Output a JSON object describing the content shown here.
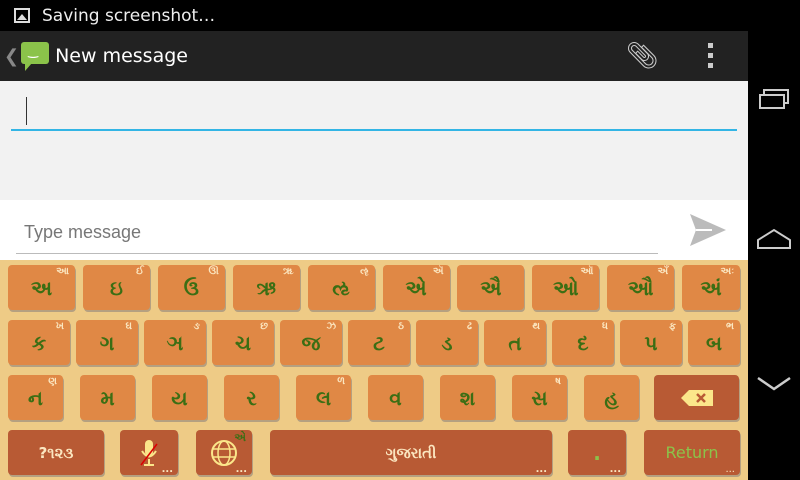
{
  "status": {
    "text": "Saving screenshot…"
  },
  "action_bar": {
    "title": "New message"
  },
  "recipient": {
    "value": ""
  },
  "compose": {
    "placeholder": "Type message"
  },
  "keyboard": {
    "row1": [
      [
        "અ",
        "આ"
      ],
      [
        "ઇ",
        "ઈ"
      ],
      [
        "ઉ",
        "ઊ"
      ],
      [
        "ઋ",
        "ૠ"
      ],
      [
        "ઌ",
        "ૡ"
      ],
      [
        "એ",
        "ઍ"
      ],
      [
        "ઐ",
        ""
      ],
      [
        "ઓ",
        "ઑ"
      ],
      [
        "ઔ",
        "અઁ"
      ],
      [
        "અં",
        "અઃ"
      ]
    ],
    "row2": [
      [
        "ક",
        "ખ"
      ],
      [
        "ગ",
        "ઘ"
      ],
      [
        "ઞ",
        "ઙ"
      ],
      [
        "ચ",
        "છ"
      ],
      [
        "જ",
        "ઝ"
      ],
      [
        "ટ",
        "ઠ"
      ],
      [
        "ડ",
        "ઢ"
      ],
      [
        "ત",
        "થ"
      ],
      [
        "દ",
        "ધ"
      ],
      [
        "પ",
        "ફ"
      ],
      [
        "બ",
        "ભ"
      ]
    ],
    "row3": [
      [
        "ન",
        "ણ"
      ],
      [
        "મ",
        ""
      ],
      [
        "ય",
        ""
      ],
      [
        "ર",
        ""
      ],
      [
        "લ",
        "ળ"
      ],
      [
        "વ",
        ""
      ],
      [
        "શ",
        ""
      ],
      [
        "સ",
        "ષ"
      ],
      [
        "હ",
        ""
      ]
    ],
    "symbols_label": "?૧૨૩",
    "space_label": "ગુજરાતી",
    "period_label": ".",
    "return_label": "Return",
    "globe_hint": "એ",
    "more_hint": "..."
  }
}
